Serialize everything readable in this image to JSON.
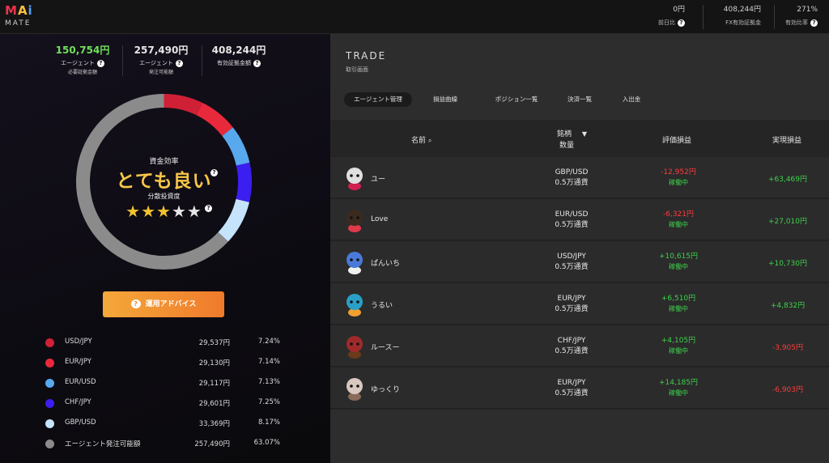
{
  "app": {
    "logo_text": "MAi",
    "logo_sub": "MATE"
  },
  "header": {
    "stats": [
      {
        "value": "0円",
        "label": "前日比"
      },
      {
        "value": "408,244円",
        "label": "FX有効証拠金"
      },
      {
        "value": "271%",
        "label": "有効比率"
      }
    ]
  },
  "left": {
    "stats": [
      {
        "value": "150,754円",
        "label": "エージェント",
        "label2": "必要証拠金額",
        "color": "#6fe05a"
      },
      {
        "value": "257,490円",
        "label": "エージェント",
        "label2": "発注可能額",
        "color": "#e6e6e6"
      },
      {
        "value": "408,244円",
        "label": "有効証拠金額",
        "label2": "",
        "color": "#e6e6e6"
      }
    ],
    "efficiency_label": "資金効率",
    "efficiency_value": "とても良い",
    "diversification_label": "分散投資度",
    "stars": {
      "rating": 3,
      "max": 5
    },
    "advice_button": "運用アドバイス",
    "allocation": [
      {
        "name": "USD/JPY",
        "amount": "29,537円",
        "pct": "7.24%",
        "percent": 7.24,
        "color": "#cf2036"
      },
      {
        "name": "EUR/JPY",
        "amount": "29,130円",
        "pct": "7.14%",
        "percent": 7.14,
        "color": "#e8293c"
      },
      {
        "name": "EUR/USD",
        "amount": "29,117円",
        "pct": "7.13%",
        "percent": 7.13,
        "color": "#58a8ee"
      },
      {
        "name": "CHF/JPY",
        "amount": "29,601円",
        "pct": "7.25%",
        "percent": 7.25,
        "color": "#3b1ef0"
      },
      {
        "name": "GBP/USD",
        "amount": "33,369円",
        "pct": "8.17%",
        "percent": 8.17,
        "color": "#c5e3fb"
      },
      {
        "name": "エージェント発注可能額",
        "amount": "257,490円",
        "pct": "63.07%",
        "percent": 63.07,
        "color": "#8b8b8b"
      }
    ]
  },
  "trade": {
    "title": "TRADE",
    "subtitle": "取引画面",
    "tabs": [
      "エージェント管理",
      "損益曲線",
      "ポジション一覧",
      "決済一覧",
      "入出金"
    ],
    "columns": {
      "name": "名前",
      "symbol": "銘柄",
      "qty": "数量",
      "unrealized": "評価損益",
      "realized": "実現損益"
    },
    "rows": [
      {
        "name": "ユー",
        "pair": "GBP/USD",
        "qty": "0.5万通貨",
        "unrealized": "-12,952円",
        "status": "稼働中",
        "realized": "+63,469円",
        "u_sign": "neg",
        "r_sign": "pos",
        "avatar_color": "#e0e0e0",
        "avatar_accent": "#d02050"
      },
      {
        "name": "Love",
        "pair": "EUR/USD",
        "qty": "0.5万通貨",
        "unrealized": "-6,321円",
        "status": "稼働中",
        "realized": "+27,010円",
        "u_sign": "neg",
        "r_sign": "pos",
        "avatar_color": "#3a2a20",
        "avatar_accent": "#e03a4a"
      },
      {
        "name": "ぱんいち",
        "pair": "USD/JPY",
        "qty": "0.5万通貨",
        "unrealized": "+10,615円",
        "status": "稼働中",
        "realized": "+10,730円",
        "u_sign": "pos",
        "r_sign": "pos",
        "avatar_color": "#4a7ad8",
        "avatar_accent": "#f0f0f0"
      },
      {
        "name": "うるい",
        "pair": "EUR/JPY",
        "qty": "0.5万通貨",
        "unrealized": "+6,510円",
        "status": "稼働中",
        "realized": "+4,832円",
        "u_sign": "pos",
        "r_sign": "pos",
        "avatar_color": "#2aa0c8",
        "avatar_accent": "#f0a030"
      },
      {
        "name": "ルースー",
        "pair": "CHF/JPY",
        "qty": "0.5万通貨",
        "unrealized": "+4,105円",
        "status": "稼働中",
        "realized": "-3,905円",
        "u_sign": "pos",
        "r_sign": "neg",
        "avatar_color": "#a02a2a",
        "avatar_accent": "#6a3a1a"
      },
      {
        "name": "ゆっくり",
        "pair": "EUR/JPY",
        "qty": "0.5万通貨",
        "unrealized": "+14,185円",
        "status": "稼働中",
        "realized": "-6,903円",
        "u_sign": "pos",
        "r_sign": "neg",
        "avatar_color": "#d8c8c0",
        "avatar_accent": "#8a6a5a"
      }
    ]
  }
}
